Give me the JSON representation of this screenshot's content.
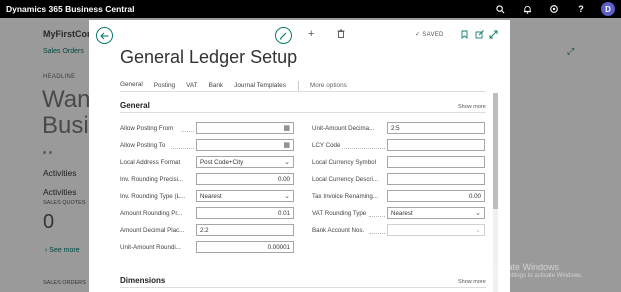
{
  "suitebar": {
    "title": "Dynamics 365 Business Central",
    "avatar_initial": "D",
    "icons": [
      "search-icon",
      "bell-icon",
      "gear-icon",
      "help-icon"
    ]
  },
  "background": {
    "company": "MyFirstCom",
    "sales_orders_link": "Sales Orders",
    "headline_label": "HEADLINE",
    "headline_line1": "Want",
    "headline_line2": "Busin",
    "activities_title": "Activities",
    "activities_subtitle": "Activities",
    "sales_quotes_label": "SALES QUOTES",
    "sales_quotes_value": "0",
    "see_more": "See more",
    "sales_orders_label": "SALES ORDERS"
  },
  "watermark": {
    "line1": "Activate Windows",
    "line2": "Go to Settings to activate Windows."
  },
  "dialog": {
    "title": "General Ledger Setup",
    "saved_label": "SAVED",
    "tabs": [
      "General",
      "Posting",
      "VAT",
      "Bank",
      "Journal Templates"
    ],
    "more_options": "More options",
    "general_section": "General",
    "show_more": "Show more",
    "dimensions_section": "Dimensions",
    "left_fields": [
      {
        "label": "Allow Posting From",
        "value": "",
        "kind": "date"
      },
      {
        "label": "Allow Posting To",
        "value": "",
        "kind": "date"
      },
      {
        "label": "Local Address Format",
        "value": "Post Code+City",
        "kind": "select"
      },
      {
        "label": "Inv. Rounding Precisi...",
        "value": "0.00",
        "kind": "number"
      },
      {
        "label": "Inv. Rounding Type (L...",
        "value": "Nearest",
        "kind": "select"
      },
      {
        "label": "Amount Rounding Pr...",
        "value": "0.01",
        "kind": "number"
      },
      {
        "label": "Amount Decimal Plac...",
        "value": "2:2",
        "kind": "text"
      },
      {
        "label": "Unit-Amount Roundi...",
        "value": "0.00001",
        "kind": "number"
      }
    ],
    "right_fields": [
      {
        "label": "Unit-Amount Decima...",
        "value": "2:5",
        "kind": "text"
      },
      {
        "label": "LCY Code",
        "value": "",
        "kind": "text"
      },
      {
        "label": "Local Currency Symbol",
        "value": "",
        "kind": "text"
      },
      {
        "label": "Local Currency Descri...",
        "value": "",
        "kind": "text"
      },
      {
        "label": "Tax Invoice Renaming...",
        "value": "0.00",
        "kind": "number"
      },
      {
        "label": "VAT Rounding Type",
        "value": "Nearest",
        "kind": "select"
      },
      {
        "label": "Bank Account Nos.",
        "value": "",
        "kind": "select-disabled"
      }
    ]
  }
}
